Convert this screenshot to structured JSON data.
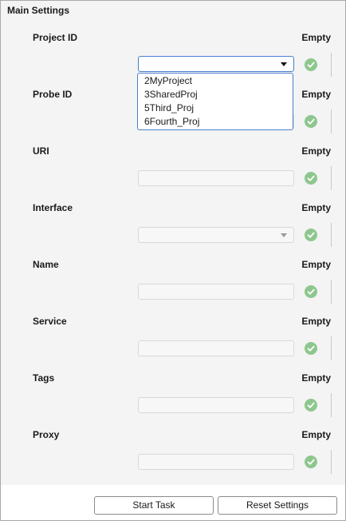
{
  "panel": {
    "title": "Main Settings"
  },
  "rows": [
    {
      "label": "Project ID",
      "status": "Empty",
      "control": "dropdown",
      "value": ""
    },
    {
      "label": "Probe ID",
      "status": "Empty",
      "control": "text",
      "value": ""
    },
    {
      "label": "URI",
      "status": "Empty",
      "control": "text",
      "value": ""
    },
    {
      "label": "Interface",
      "status": "Empty",
      "control": "dropdown",
      "value": ""
    },
    {
      "label": "Name",
      "status": "Empty",
      "control": "text",
      "value": ""
    },
    {
      "label": "Service",
      "status": "Empty",
      "control": "text",
      "value": ""
    },
    {
      "label": "Tags",
      "status": "Empty",
      "control": "text",
      "value": ""
    },
    {
      "label": "Proxy",
      "status": "Empty",
      "control": "text",
      "value": ""
    }
  ],
  "project_dropdown": {
    "options": [
      "2MyProject",
      "3SharedProj",
      "5Third_Proj",
      "6Fourth_Proj"
    ]
  },
  "buttons": {
    "start": "Start Task",
    "reset": "Reset Settings"
  },
  "colors": {
    "accent": "#4a7fd0",
    "check": "#8ec78e",
    "panel_bg": "#f4f4f4"
  },
  "icons": {
    "valid": "check-circle-icon",
    "dropdown": "chevron-down-icon"
  }
}
